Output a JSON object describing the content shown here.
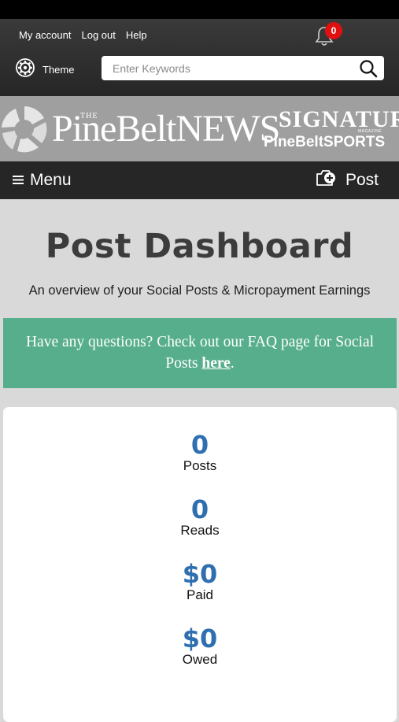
{
  "header": {
    "links": [
      "My account",
      "Log out",
      "Help"
    ],
    "notification_count": "0",
    "theme_label": "Theme",
    "search_placeholder": "Enter Keywords"
  },
  "banner": {
    "site_name_prefix": "THE",
    "site_name": "PineBeltNEWS",
    "partner_top": "SIGNATURE",
    "partner_small": "MAGAZINE",
    "partner_bottom": "PineBeltSPORTS"
  },
  "nav": {
    "menu_label": "Menu",
    "post_label": "Post"
  },
  "page": {
    "title": "Post Dashboard",
    "subtitle": "An overview of your Social Posts & Micropayment Earnings"
  },
  "faq": {
    "text_before": "Have any questions? Check out our FAQ page for Social Posts ",
    "link_text": "here",
    "text_after": "."
  },
  "stats": [
    {
      "value": "0",
      "label": "Posts"
    },
    {
      "value": "0",
      "label": "Reads"
    },
    {
      "value": "$0",
      "label": "Paid"
    },
    {
      "value": "$0",
      "label": "Owed"
    }
  ],
  "colors": {
    "faq_background": "#57ae8c",
    "stat_value": "#2f6fb0",
    "badge": "#e01010"
  },
  "icons": [
    "bell-icon",
    "gear-icon",
    "search-icon",
    "hamburger-icon",
    "camera-plus-icon"
  ]
}
